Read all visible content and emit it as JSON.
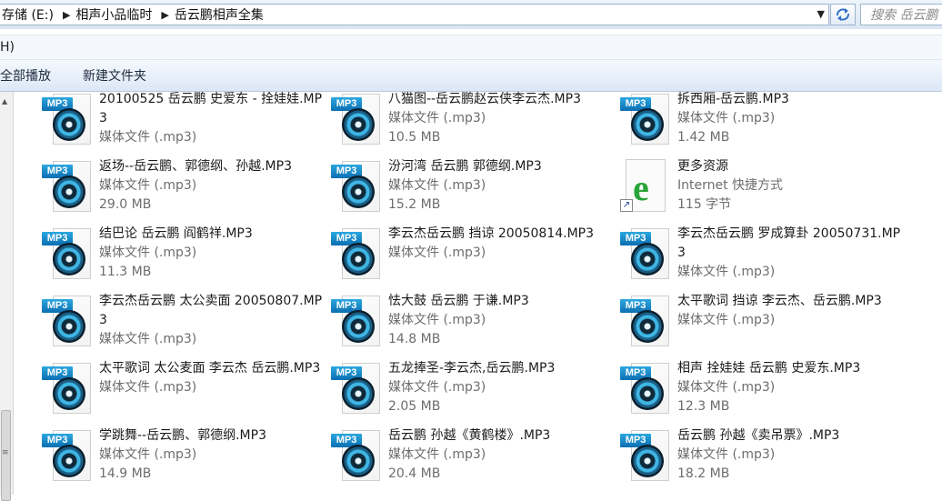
{
  "address": {
    "crumbs": [
      "存储 (E:)",
      "相声小品临时",
      "岳云鹏相声全集"
    ],
    "search_placeholder": "搜索 岳云鹏"
  },
  "menu": {
    "partial_label": "H)"
  },
  "commands": [
    "全部播放",
    "新建文件夹"
  ],
  "files": [
    {
      "name": "20100525 岳云鹏 史爱东 - 拴娃娃.MP3",
      "type": "媒体文件 (.mp3)",
      "size": "",
      "icon": "mp3-icon"
    },
    {
      "name": "八猫图--岳云鹏赵云侠李云杰.MP3",
      "type": "媒体文件 (.mp3)",
      "size": "10.5 MB",
      "icon": "mp3-icon"
    },
    {
      "name": "拆西厢-岳云鹏.MP3",
      "type": "媒体文件 (.mp3)",
      "size": "1.42 MB",
      "icon": "mp3-icon"
    },
    {
      "name": "返场--岳云鹏、郭德纲、孙越.MP3",
      "type": "媒体文件 (.mp3)",
      "size": "29.0 MB",
      "icon": "mp3-icon"
    },
    {
      "name": "汾河湾 岳云鹏 郭德纲.MP3",
      "type": "媒体文件 (.mp3)",
      "size": "15.2 MB",
      "icon": "mp3-icon"
    },
    {
      "name": "更多资源",
      "type": "Internet 快捷方式",
      "size": "115 字节",
      "icon": "internet-shortcut-icon"
    },
    {
      "name": "结巴论 岳云鹏 阎鹤祥.MP3",
      "type": "媒体文件 (.mp3)",
      "size": "11.3 MB",
      "icon": "mp3-icon"
    },
    {
      "name": "李云杰岳云鹏 挡谅 20050814.MP3",
      "type": "媒体文件 (.mp3)",
      "size": "",
      "icon": "mp3-icon"
    },
    {
      "name": "李云杰岳云鹏 罗成算卦 20050731.MP3",
      "type": "媒体文件 (.mp3)",
      "size": "",
      "icon": "mp3-icon"
    },
    {
      "name": "李云杰岳云鹏 太公卖面 20050807.MP3",
      "type": "媒体文件 (.mp3)",
      "size": "",
      "icon": "mp3-icon"
    },
    {
      "name": "怯大鼓 岳云鹏 于谦.MP3",
      "type": "媒体文件 (.mp3)",
      "size": "14.8 MB",
      "icon": "mp3-icon"
    },
    {
      "name": "太平歌词 挡谅 李云杰、岳云鹏.MP3",
      "type": "媒体文件 (.mp3)",
      "size": "",
      "icon": "mp3-icon"
    },
    {
      "name": "太平歌词 太公麦面 李云杰 岳云鹏.MP3",
      "type": "媒体文件 (.mp3)",
      "size": "",
      "icon": "mp3-icon"
    },
    {
      "name": "五龙捧圣-李云杰,岳云鹏.MP3",
      "type": "媒体文件 (.mp3)",
      "size": "2.05 MB",
      "icon": "mp3-icon"
    },
    {
      "name": "相声 拴娃娃 岳云鹏 史爱东.MP3",
      "type": "媒体文件 (.mp3)",
      "size": "12.3 MB",
      "icon": "mp3-icon"
    },
    {
      "name": "学跳舞--岳云鹏、郭德纲.MP3",
      "type": "媒体文件 (.mp3)",
      "size": "14.9 MB",
      "icon": "mp3-icon"
    },
    {
      "name": "岳云鹏 孙越《黄鹤楼》.MP3",
      "type": "媒体文件 (.mp3)",
      "size": "20.4 MB",
      "icon": "mp3-icon"
    },
    {
      "name": "岳云鹏 孙越《卖吊票》.MP3",
      "type": "媒体文件 (.mp3)",
      "size": "18.2 MB",
      "icon": "mp3-icon"
    }
  ]
}
